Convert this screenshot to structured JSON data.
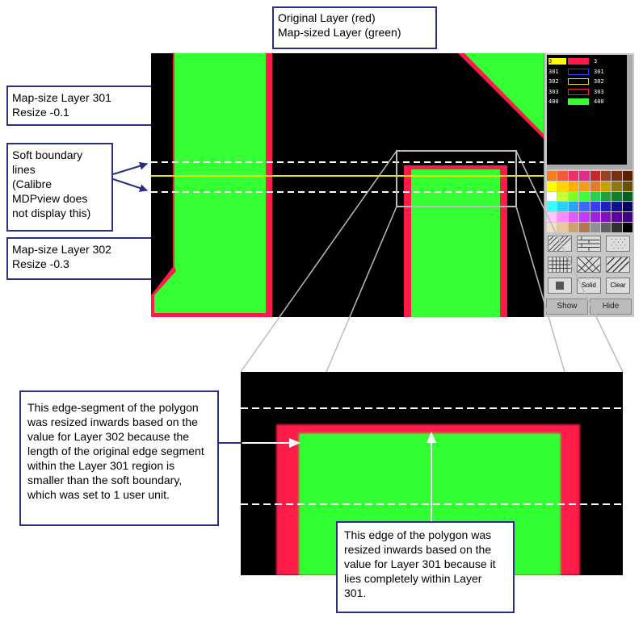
{
  "callouts": {
    "legend_title": "Original Layer (red)\nMap-sized Layer (green)",
    "map301": "Map-size Layer 301\nResize -0.1",
    "soft_boundary": "Soft boundary\nlines\n(Calibre\nMDPview does\nnot display this)",
    "map302": "Map-size Layer 302\nResize -0.3",
    "edge_segment": "This edge-segment of the polygon was resized inwards based on the value for Layer 302 because the length of the original edge segment within the Layer 301 region is smaller than the soft boundary, which was set to 1 user unit.",
    "edge_polygon": "This edge of the polygon was resized inwards based on the value for Layer 301 because it lies completely within Layer 301."
  },
  "layer_legend": [
    {
      "left": "3",
      "right": "3",
      "style": "fill",
      "color": "#ffff00",
      "color2": "#ff1a4a"
    },
    {
      "left": "301",
      "right": "301",
      "style": "outline",
      "color": "#3a3aff"
    },
    {
      "left": "302",
      "right": "302",
      "style": "outline",
      "color": "#e8e800"
    },
    {
      "left": "303",
      "right": "303",
      "style": "outline",
      "color": "#ff1a4a"
    },
    {
      "left": "400",
      "right": "400",
      "style": "fill",
      "color": "#33ff33"
    }
  ],
  "panel_buttons": {
    "solid": "Solid",
    "clear": "Clear",
    "show": "Show",
    "hide": "Hide"
  },
  "colors": {
    "original_layer": "#ff1a4a",
    "map_sized_layer": "#33ff33",
    "layer_302_line": "#e8e800",
    "callout_border": "#2a2f84",
    "background": "#000000"
  },
  "palette": [
    "#f47f20",
    "#f25a3a",
    "#ee2d6b",
    "#e32b8f",
    "#c22a2a",
    "#9a4020",
    "#7a3010",
    "#5a2000",
    "#ffff00",
    "#ffd200",
    "#ffb000",
    "#f79a1e",
    "#e07b2a",
    "#c8a000",
    "#8a7a10",
    "#6b5000",
    "#ffffff",
    "#c8ff3a",
    "#7aff2a",
    "#3aff3a",
    "#2ad04a",
    "#20a040",
    "#108030",
    "#006020",
    "#3affff",
    "#2ad0ff",
    "#2aa0ff",
    "#3a6aff",
    "#3a3aff",
    "#2020c0",
    "#101090",
    "#000060",
    "#ffc8ff",
    "#ff8aff",
    "#e05aff",
    "#c03aff",
    "#a020e0",
    "#8010c0",
    "#6000a0",
    "#400080",
    "#f0e0c8",
    "#e8c8a0",
    "#d0a070",
    "#b07850",
    "#909090",
    "#606060",
    "#303030",
    "#000000"
  ]
}
